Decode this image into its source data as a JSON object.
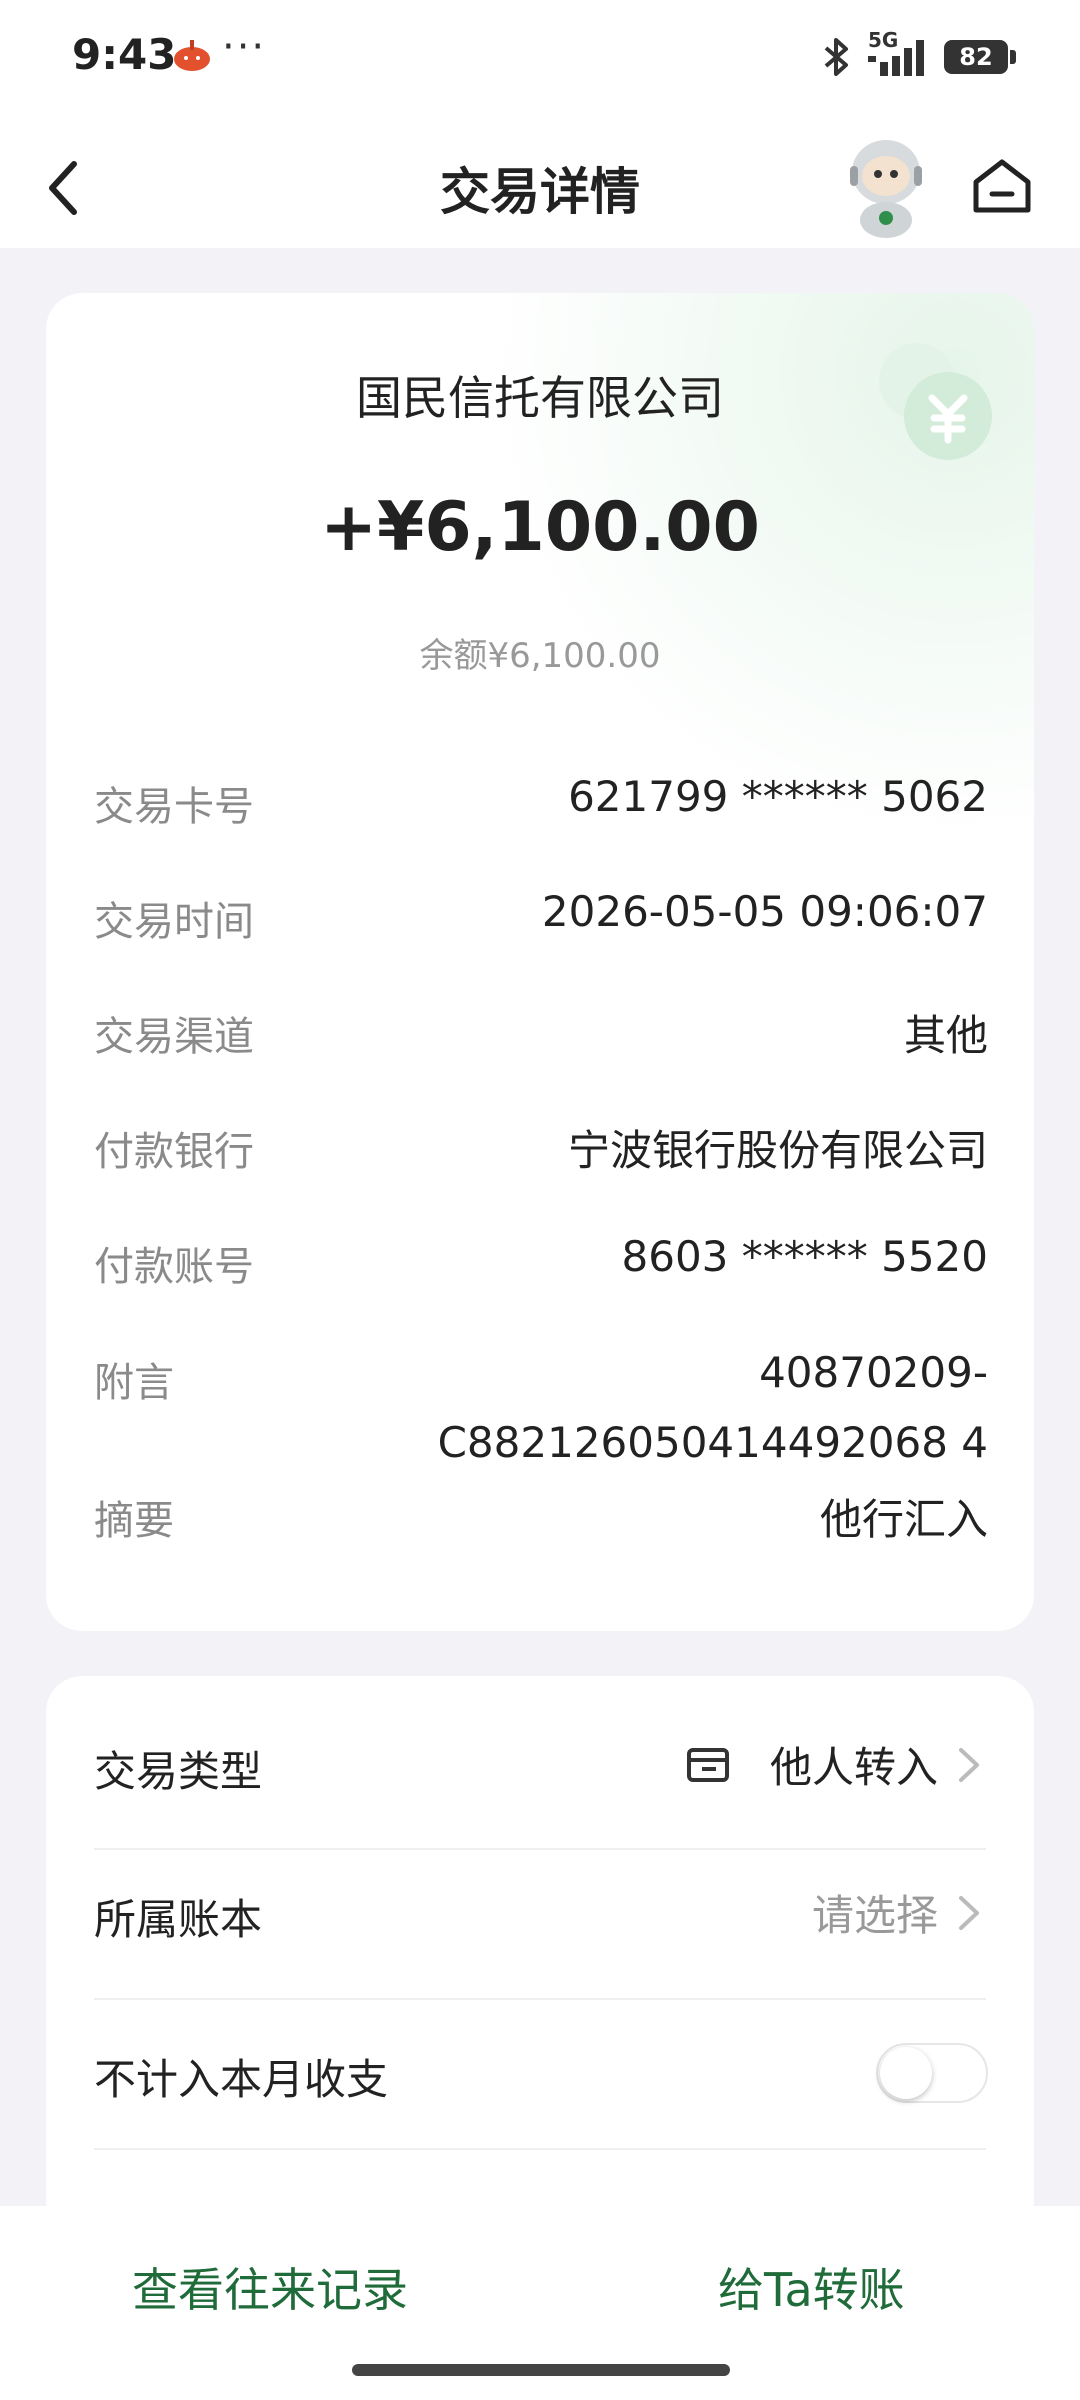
{
  "status": {
    "time": "9:43",
    "more": "···",
    "network": "5G",
    "battery": "82"
  },
  "nav": {
    "title": "交易详情"
  },
  "summary": {
    "company": "国民信托有限公司",
    "amount": "+¥6,100.00",
    "balance": "余额¥6,100.00"
  },
  "details": [
    {
      "label": "交易卡号",
      "value": "621799 ****** 5062"
    },
    {
      "label": "交易时间",
      "value": "2026-05-05 09:06:07"
    },
    {
      "label": "交易渠道",
      "value": "其他"
    },
    {
      "label": "付款银行",
      "value": "宁波银行股份有限公司"
    },
    {
      "label": "付款账号",
      "value": "8603 ****** 5520"
    },
    {
      "label": "附言",
      "value_line1": "40870209-",
      "value_line2": "C882126050414492068 4"
    },
    {
      "label": "摘要",
      "value": "他行汇入"
    }
  ],
  "settings": {
    "type_label": "交易类型",
    "type_value": "他人转入",
    "book_label": "所属账本",
    "book_value": "请选择",
    "exclude_label": "不计入本月收支",
    "exclude_on": false
  },
  "bottom": {
    "history": "查看往来记录",
    "transfer": "给Ta转账"
  },
  "colors": {
    "accent": "#1f6b3a",
    "background": "#f3f3f7"
  }
}
